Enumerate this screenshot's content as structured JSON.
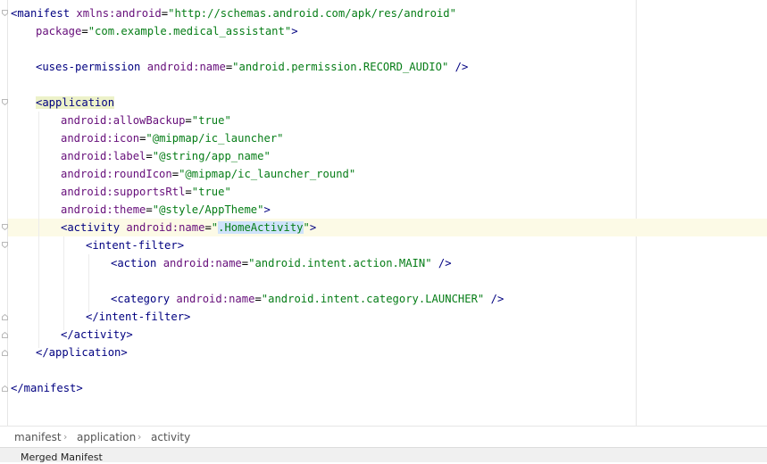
{
  "editor": {
    "lines": {
      "l1": {
        "t1": "<manifest ",
        "a1": "xmlns:android",
        "eq1": "=",
        "v1": "\"http://schemas.android.com/apk/res/android\""
      },
      "l2": {
        "a1": "package",
        "eq1": "=",
        "v1": "\"com.example.medical_assistant\"",
        "t1": ">"
      },
      "l4": {
        "t1": "<uses-permission ",
        "a1": "android:name",
        "eq1": "=",
        "v1": "\"android.permission.RECORD_AUDIO\"",
        "t2": " />"
      },
      "l6": {
        "lt": "<",
        "tag": "application"
      },
      "l7": {
        "a1": "android:allowBackup",
        "eq1": "=",
        "v1": "\"true\""
      },
      "l8": {
        "a1": "android:icon",
        "eq1": "=",
        "v1": "\"@mipmap/ic_launcher\""
      },
      "l9": {
        "a1": "android:label",
        "eq1": "=",
        "v1": "\"@string/app_name\""
      },
      "l10": {
        "a1": "android:roundIcon",
        "eq1": "=",
        "v1": "\"@mipmap/ic_launcher_round\""
      },
      "l11": {
        "a1": "android:supportsRtl",
        "eq1": "=",
        "v1": "\"true\""
      },
      "l12": {
        "a1": "android:theme",
        "eq1": "=",
        "v1": "\"@style/AppTheme\"",
        "t1": ">"
      },
      "l13": {
        "t1": "<activity ",
        "a1": "android:name",
        "eq1": "=",
        "q1": "\"",
        "v1": ".HomeActivity",
        "q2": "\"",
        "t2": ">"
      },
      "l14": {
        "t1": "<intent-filter>"
      },
      "l15": {
        "t1": "<action ",
        "a1": "android:name",
        "eq1": "=",
        "v1": "\"android.intent.action.MAIN\"",
        "t2": " />"
      },
      "l17": {
        "t1": "<category ",
        "a1": "android:name",
        "eq1": "=",
        "v1": "\"android.intent.category.LAUNCHER\"",
        "t2": " />"
      },
      "l18": {
        "t1": "</intent-filter>"
      },
      "l19": {
        "t1": "</activity>"
      },
      "l20": {
        "t1": "</application>"
      },
      "l22": {
        "t1": "</manifest>"
      }
    }
  },
  "breadcrumb": {
    "items": [
      "manifest",
      "application",
      "activity"
    ],
    "separator": "›"
  },
  "bottom_tabs": {
    "merged_manifest": "Merged Manifest"
  },
  "colors": {
    "tag": "#000080",
    "attr_name": "#660e7a",
    "attr_value": "#067d17",
    "caret_line": "#fcfae6",
    "tag_match": "#edf2c9",
    "selection": "#cfe3fb"
  }
}
